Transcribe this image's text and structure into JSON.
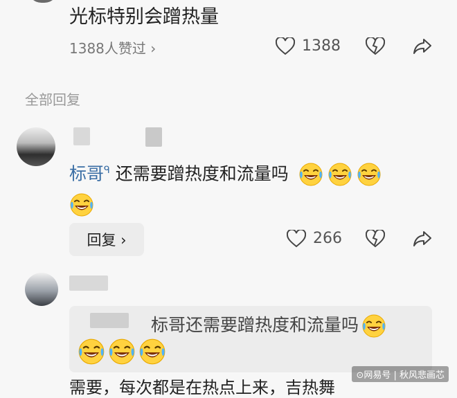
{
  "top_comment": {
    "text": "光标特别会蹭热量",
    "likes_summary": "1388人赞过 ›",
    "like_count": "1388"
  },
  "section": {
    "title": "全部回复"
  },
  "reply1": {
    "username": "标哥",
    "text": "还需要蹭热度和流量吗",
    "emojis": [
      "laughing-crying",
      "laughing-crying",
      "laughing-crying",
      "laughing-crying"
    ],
    "reply_button": "回复 ›",
    "like_count": "266"
  },
  "reply2": {
    "quote_text": "标哥还需要蹭热度和流量吗",
    "emojis": [
      "laughing-crying",
      "laughing-crying",
      "laughing-crying",
      "laughing-crying"
    ],
    "text": "需要，每次都是在热点上来，吉热舞"
  },
  "watermark": "⊙网易号 | 秋风悲画芯",
  "icons": [
    "heart-icon",
    "dislike-heart-icon",
    "share-icon",
    "laughing-crying-emoji"
  ]
}
